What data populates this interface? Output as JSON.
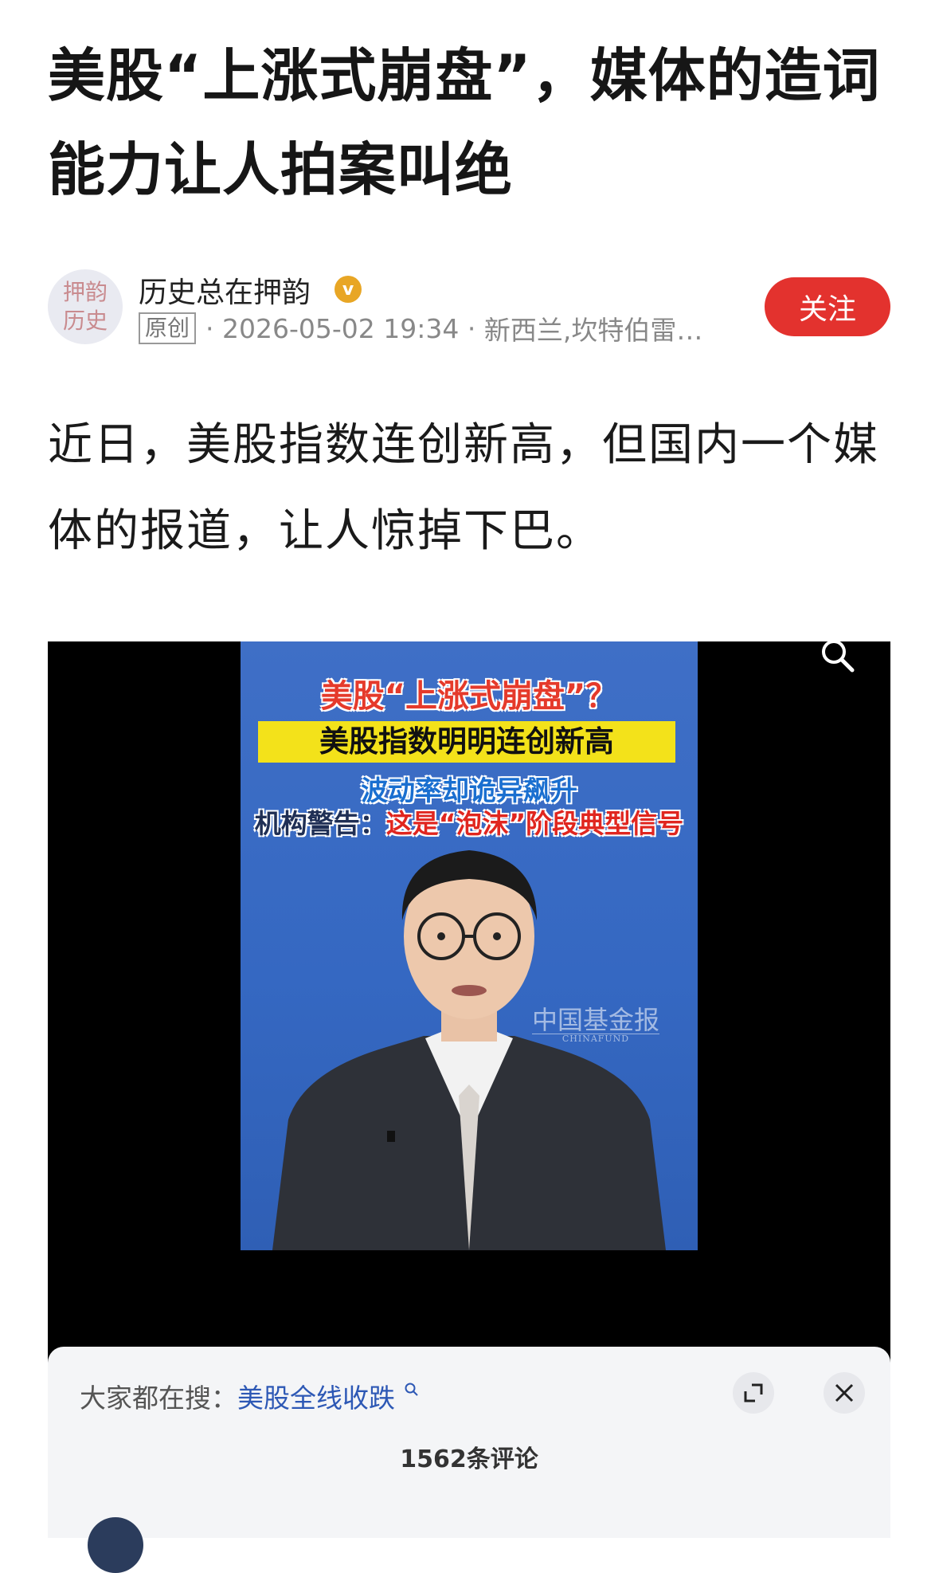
{
  "article": {
    "title": "美股“上涨式崩盘”，媒体的造词能力让人拍案叫绝",
    "body": "近日，美股指数连创新高，但国内一个媒体的报道，让人惊掉下巴。"
  },
  "author": {
    "avatar_text_1": "押韵",
    "avatar_text_2": "历史",
    "name": "历史总在押韵",
    "original_badge": "原创",
    "timestamp": "2026-05-02 19:34",
    "location": "新西兰,坎特伯雷…",
    "follow_label": "关注"
  },
  "video": {
    "headline": "美股“上涨式崩盘”？",
    "yellow_bar": "美股指数明明连创新高",
    "line3": "波动率却诡异飙升",
    "line4_prefix": "机构警告：",
    "line4_highlight": "这是“泡沫”阶段典型信号",
    "watermark": "中国基金报",
    "watermark_sub": "CHINAFUND"
  },
  "comments_panel": {
    "hot_search_label": "大家都在搜：",
    "hot_search_keyword": "美股全线收跌",
    "comment_count": "1562条评论"
  },
  "colors": {
    "follow_red": "#e3322e",
    "verified_gold": "#e8a625",
    "keyword_blue": "#2d58b5",
    "video_blue": "#3568c2"
  }
}
